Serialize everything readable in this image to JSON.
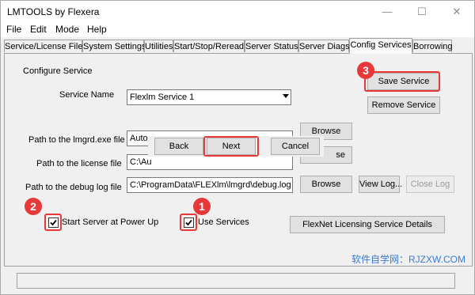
{
  "window": {
    "title": "LMTOOLS by Flexera",
    "minimize": "—",
    "maximize": "☐",
    "close": "✕"
  },
  "menu": [
    "File",
    "Edit",
    "Mode",
    "Help"
  ],
  "tabs": [
    "Service/License File",
    "System Settings",
    "Utilities",
    "Start/Stop/Reread",
    "Server Status",
    "Server Diags",
    "Config Services",
    "Borrowing"
  ],
  "active_tab": "Config Services",
  "config": {
    "section_title": "Configure Service",
    "service_name_label": "Service Name",
    "service_name_value": "Flexlm Service 1",
    "save_service": "Save Service",
    "remove_service": "Remove Service",
    "lmgrd_label": "Path to the lmgrd.exe file",
    "lmgrd_value": "Auto",
    "license_label": "Path to the license file",
    "license_value": "C:\\Au",
    "debug_label": "Path to the debug log file",
    "debug_value": "C:\\ProgramData\\FLEXlm\\lmgrd\\debug.log",
    "browse": "Browse",
    "browse_partial": "se",
    "view_log": "View Log...",
    "close_log": "Close Log",
    "start_at_power_up": "Start Server at Power Up",
    "start_checked": true,
    "use_services": "Use Services",
    "use_services_checked": true,
    "details_button": "FlexNet Licensing Service Details"
  },
  "wizard": {
    "back": "Back",
    "next": "Next",
    "cancel": "Cancel"
  },
  "annotations": {
    "badge1": "1",
    "badge2": "2",
    "badge3": "3",
    "color": "#e8393a"
  },
  "watermark": "软件自学网：RJZXW.COM",
  "status_text": ""
}
